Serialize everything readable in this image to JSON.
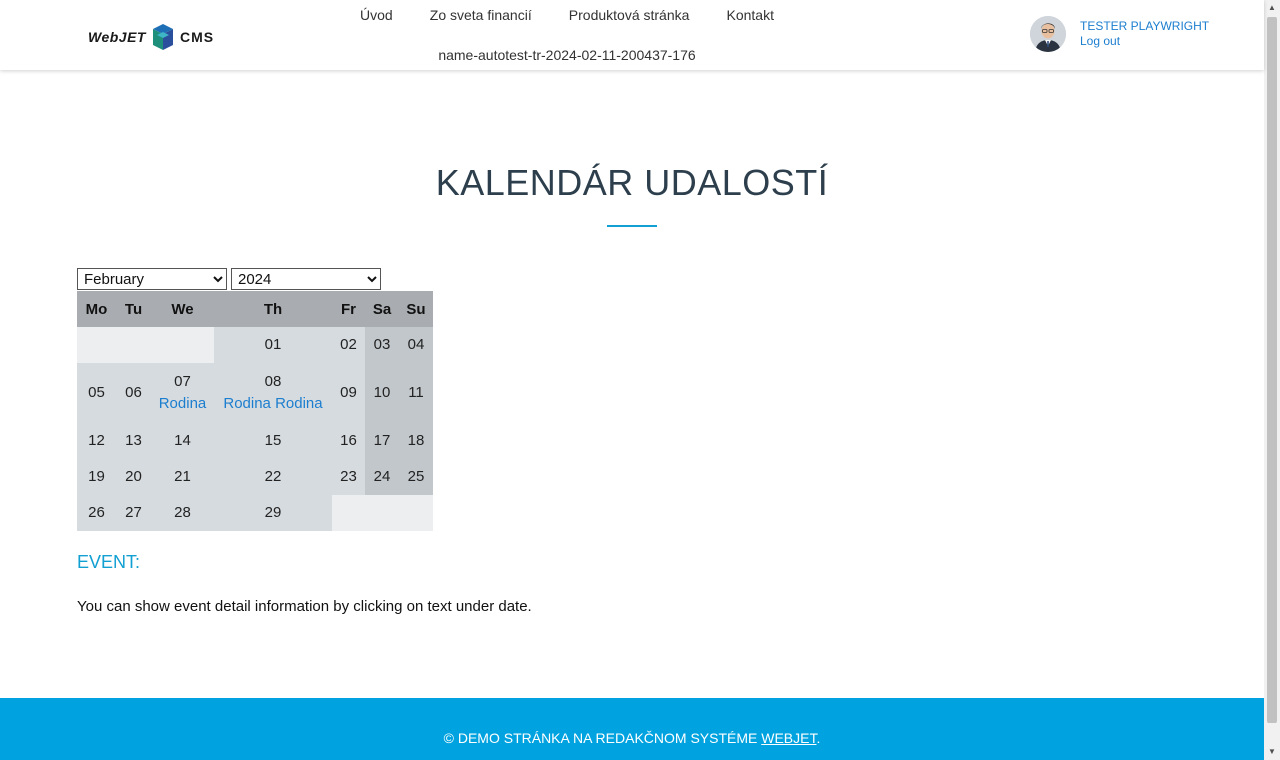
{
  "header": {
    "logo": {
      "left": "WebJET",
      "right": "CMS"
    },
    "nav": [
      {
        "label": "Úvod"
      },
      {
        "label": "Zo sveta financií"
      },
      {
        "label": "Produktová stránka"
      },
      {
        "label": "Kontakt"
      }
    ],
    "sub_nav": {
      "label": "name-autotest-tr-2024-02-11-200437-176"
    },
    "user": {
      "name": "TESTER PLAYWRIGHT",
      "logout": "Log out"
    }
  },
  "main": {
    "title": "KALENDÁR UDALOSTÍ",
    "month_select": {
      "value": "February"
    },
    "year_select": {
      "value": "2024"
    },
    "calendar": {
      "headers": [
        "Mo",
        "Tu",
        "We",
        "Th",
        "Fr",
        "Sa",
        "Su"
      ],
      "rows": [
        [
          {
            "day": "",
            "empty": true,
            "colspan": 3
          },
          {
            "day": "01"
          },
          {
            "day": "02"
          },
          {
            "day": "03",
            "weekend": true
          },
          {
            "day": "04",
            "weekend": true
          }
        ],
        [
          {
            "day": "05"
          },
          {
            "day": "06"
          },
          {
            "day": "07",
            "events": [
              "Rodina"
            ]
          },
          {
            "day": "08",
            "events": [
              "Rodina",
              "Rodina"
            ]
          },
          {
            "day": "09"
          },
          {
            "day": "10",
            "weekend": true
          },
          {
            "day": "11",
            "weekend": true
          }
        ],
        [
          {
            "day": "12"
          },
          {
            "day": "13"
          },
          {
            "day": "14"
          },
          {
            "day": "15"
          },
          {
            "day": "16"
          },
          {
            "day": "17",
            "weekend": true
          },
          {
            "day": "18",
            "weekend": true
          }
        ],
        [
          {
            "day": "19"
          },
          {
            "day": "20"
          },
          {
            "day": "21"
          },
          {
            "day": "22"
          },
          {
            "day": "23"
          },
          {
            "day": "24",
            "weekend": true
          },
          {
            "day": "25",
            "weekend": true
          }
        ],
        [
          {
            "day": "26"
          },
          {
            "day": "27"
          },
          {
            "day": "28"
          },
          {
            "day": "29"
          },
          {
            "day": "",
            "empty": true,
            "colspan": 3
          }
        ]
      ]
    },
    "event_heading": "EVENT:",
    "event_info": "You can show event detail information by clicking on text under date."
  },
  "footer": {
    "text_before": "© DEMO STRÁNKA NA REDAKČNOM SYSTÉME ",
    "link": "WEBJET",
    "text_after": "."
  },
  "colors": {
    "accent": "#00a3e0",
    "link": "#1c7ecf",
    "title": "#2d3f4c"
  }
}
